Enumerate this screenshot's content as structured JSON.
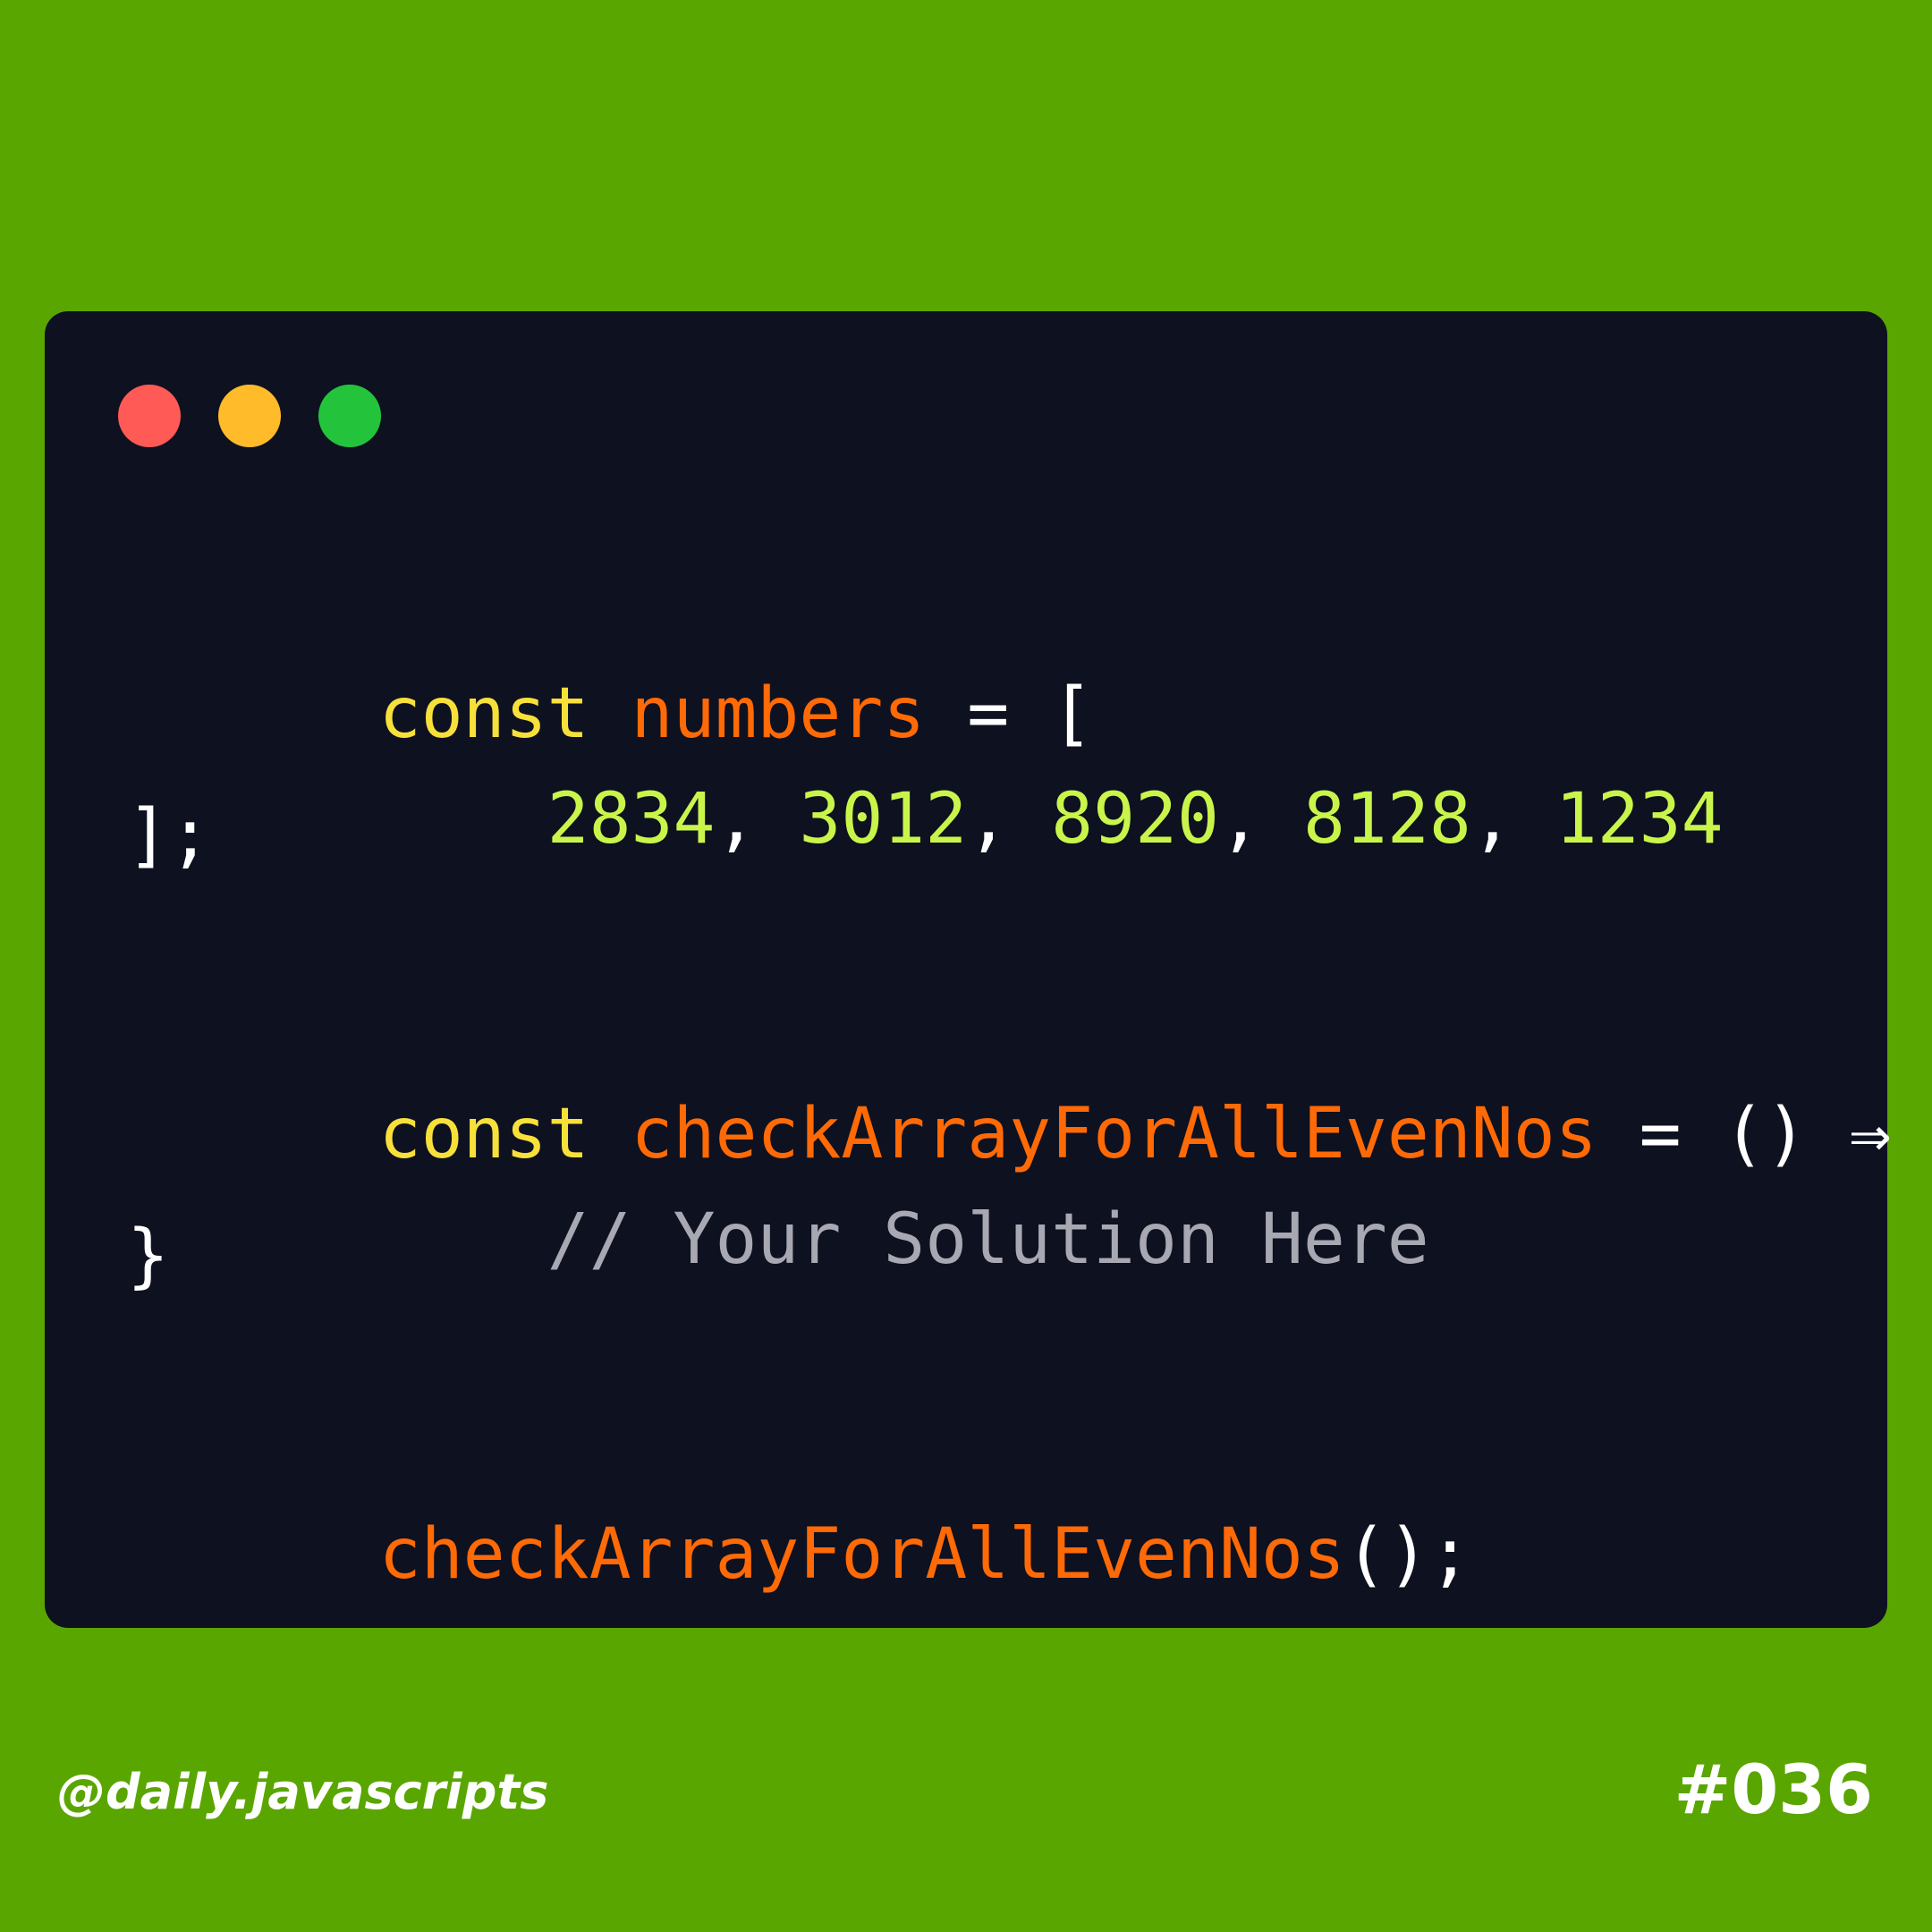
{
  "colors": {
    "background": "#5aa600",
    "window": "#0e1120",
    "red": "#ff5a55",
    "yellow": "#ffbb2a",
    "green": "#23c43c",
    "keyword": "#f7e03a",
    "identifier": "#ff6a06",
    "number": "#c9f54b",
    "punctuation": "#ffffff",
    "comment": "#a8a8b3"
  },
  "window": {
    "controls": [
      "close-button",
      "minimize-button",
      "maximize-button"
    ]
  },
  "code": {
    "line1": {
      "keyword": "const",
      "identifier": "numbers",
      "operator": "=",
      "bracket": "["
    },
    "line2": {
      "indent": "    ",
      "n1": "2834",
      "n2": "3012",
      "n3": "8920",
      "n4": "8128",
      "n5": "1234",
      "sep": ","
    },
    "line3": {
      "text": "];"
    },
    "line5": {
      "keyword": "const",
      "identifier": "checkArrayForAllEvenNos",
      "operator": "=",
      "parens": "()",
      "arrow": "⇒",
      "brace": "{"
    },
    "line6": {
      "indent": "    ",
      "comment": "// Your Solution Here"
    },
    "line7": {
      "text": "}"
    },
    "line9": {
      "identifier": "checkArrayForAllEvenNos",
      "call": "();"
    }
  },
  "footer": {
    "handle": "@daily.javascripts",
    "number": "#036"
  }
}
